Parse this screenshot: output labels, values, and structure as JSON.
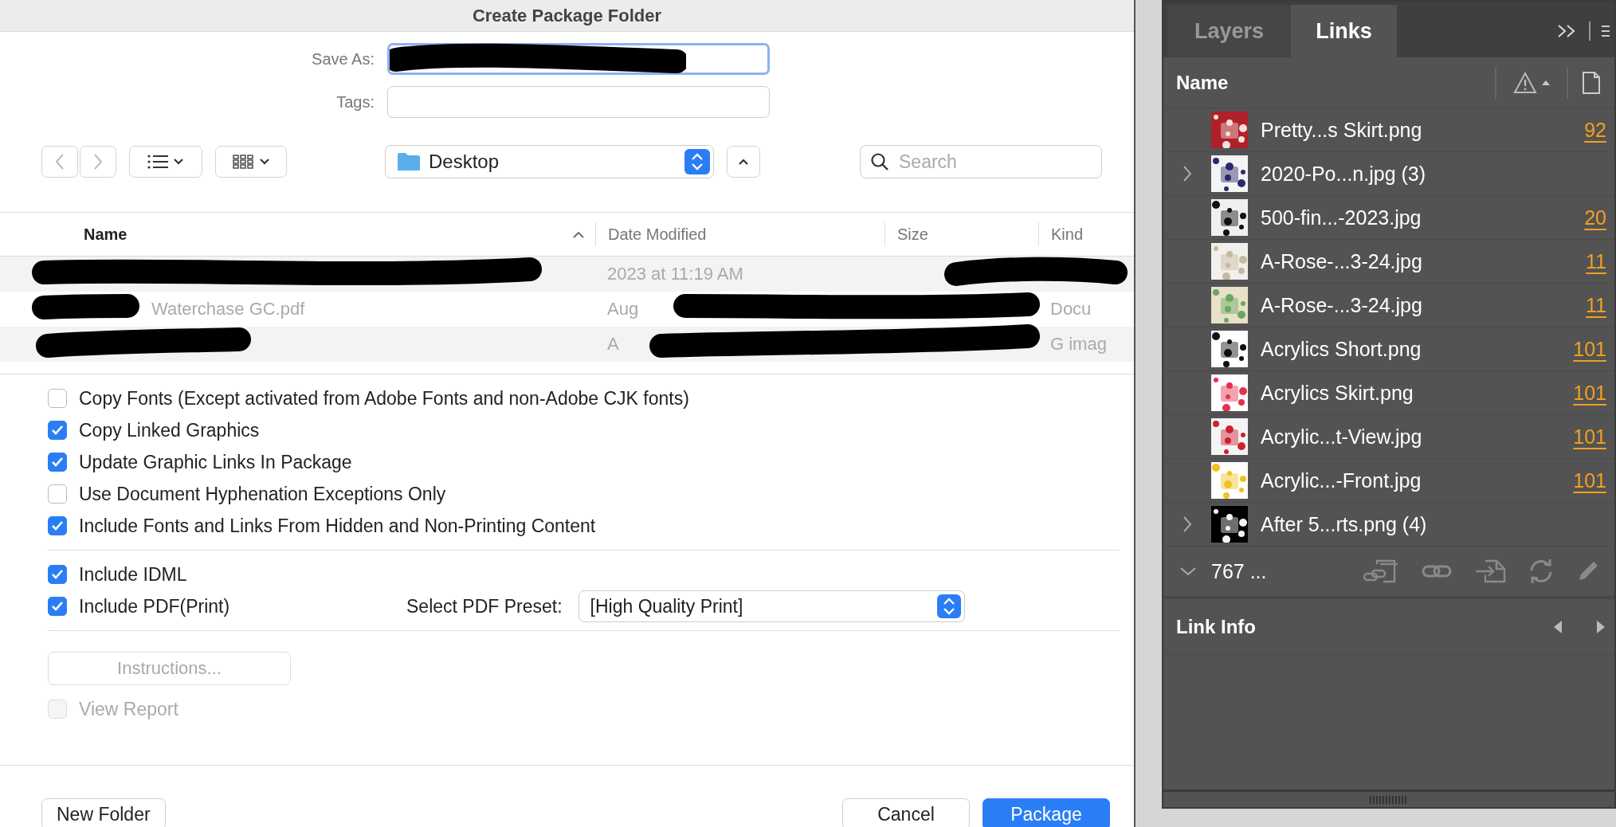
{
  "dialog": {
    "title": "Create Package Folder",
    "save_as": {
      "label": "Save As:",
      "redacted": true
    },
    "tags": {
      "label": "Tags:"
    },
    "location": "Desktop",
    "search": {
      "placeholder": "Search"
    },
    "columns": [
      "Name",
      "Date Modified",
      "Size",
      "Kind"
    ],
    "files": [
      {
        "date": "2023 at 11:19 AM"
      },
      {
        "name": "Waterchase GC.pdf",
        "date": "Aug",
        "kind": "Docu"
      },
      {
        "date": "A",
        "kind": "G imag"
      }
    ],
    "options": [
      {
        "label": "Copy Fonts (Except activated from Adobe Fonts and non-Adobe CJK fonts)",
        "checked": false
      },
      {
        "label": "Copy Linked Graphics",
        "checked": true
      },
      {
        "label": "Update Graphic Links In Package",
        "checked": true
      },
      {
        "label": "Use Document Hyphenation Exceptions Only",
        "checked": false
      },
      {
        "label": "Include Fonts and Links From Hidden and Non-Printing Content",
        "checked": true
      }
    ],
    "exports": [
      {
        "label": "Include IDML",
        "checked": true
      },
      {
        "label": "Include PDF(Print)",
        "checked": true
      }
    ],
    "pdf_preset": {
      "label": "Select PDF Preset:",
      "value": "[High Quality Print]"
    },
    "instructions": {
      "label": "Instructions...",
      "disabled": true
    },
    "view_report": {
      "label": "View Report",
      "checked": false,
      "disabled": true
    },
    "buttons": [
      {
        "label": "New Folder",
        "kind": "plain"
      },
      {
        "label": "Cancel",
        "kind": "plain"
      },
      {
        "label": "Package",
        "kind": "default"
      }
    ]
  },
  "panel": {
    "tabs": [
      {
        "label": "Layers",
        "selected": false
      },
      {
        "label": "Links",
        "selected": true
      }
    ],
    "column": "Name",
    "links": [
      {
        "name": "Pretty...s Skirt.png",
        "page": "92",
        "kind": "link"
      },
      {
        "name": "2020-Po...n.jpg (3)",
        "kind": "group"
      },
      {
        "name": "500-fin...-2023.jpg",
        "page": "20",
        "kind": "link"
      },
      {
        "name": "A-Rose-...3-24.jpg",
        "page": "11",
        "kind": "link"
      },
      {
        "name": "A-Rose-...3-24.jpg",
        "page": "11",
        "kind": "link"
      },
      {
        "name": "Acrylics Short.png",
        "page": "101",
        "kind": "link"
      },
      {
        "name": "Acrylics Skirt.png",
        "page": "101",
        "kind": "link"
      },
      {
        "name": "Acrylic...t-View.jpg",
        "page": "101",
        "kind": "link"
      },
      {
        "name": "Acrylic...-Front.jpg",
        "page": "101",
        "kind": "link"
      },
      {
        "name": "After 5...rts.png (4)",
        "kind": "group"
      }
    ],
    "count": "767 ...",
    "info_title": "Link Info"
  }
}
